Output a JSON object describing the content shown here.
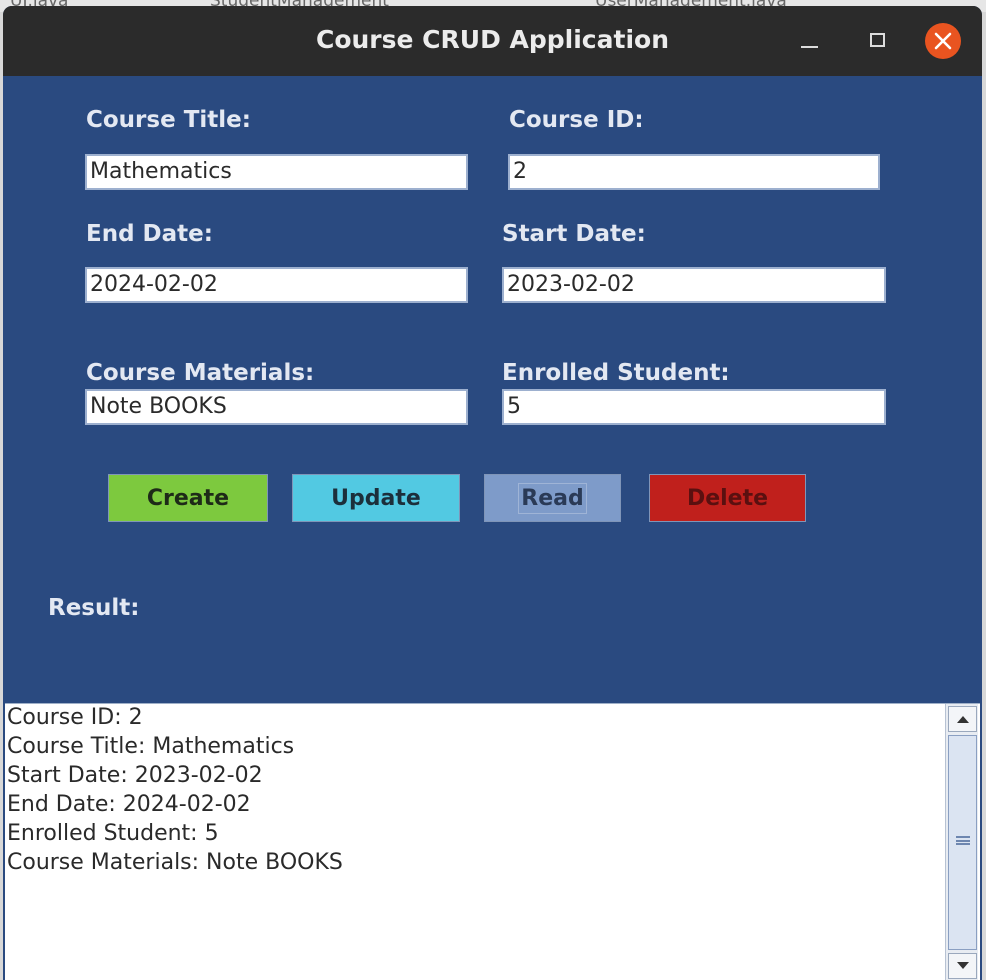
{
  "window": {
    "title": "Course CRUD Application"
  },
  "background_tabs": [
    "UI.java",
    "StudentManagement",
    "UserManagement.java"
  ],
  "form": {
    "course_title": {
      "label": "Course Title:",
      "value": "Mathematics"
    },
    "course_id": {
      "label": "Course ID:",
      "value": "2"
    },
    "end_date": {
      "label": "End Date:",
      "value": "2024-02-02"
    },
    "start_date": {
      "label": "Start Date:",
      "value": "2023-02-02"
    },
    "course_materials": {
      "label": "Course Materials:",
      "value": "Note BOOKS"
    },
    "enrolled_student": {
      "label": "Enrolled Student:",
      "value": "5"
    }
  },
  "buttons": {
    "create": "Create",
    "update": "Update",
    "read": "Read",
    "delete": "Delete"
  },
  "result": {
    "label": "Result:",
    "lines": [
      "Course ID: 2",
      "Course Title: Mathematics",
      "Start Date: 2023-02-02",
      "End Date: 2024-02-02",
      "Enrolled Student: 5",
      "Course Materials: Note BOOKS"
    ]
  },
  "colors": {
    "panel_background": "#2a4a80",
    "titlebar": "#2b2b2b",
    "close_button": "#e95420",
    "create_button": "#7dc93e",
    "update_button": "#52c9e2",
    "read_button": "#7e9bc9",
    "delete_button": "#c0201c"
  },
  "icons": [
    "minimize-icon",
    "maximize-icon",
    "close-icon",
    "scroll-up-arrow-icon",
    "scroll-down-arrow-icon",
    "scroll-grip-icon"
  ]
}
